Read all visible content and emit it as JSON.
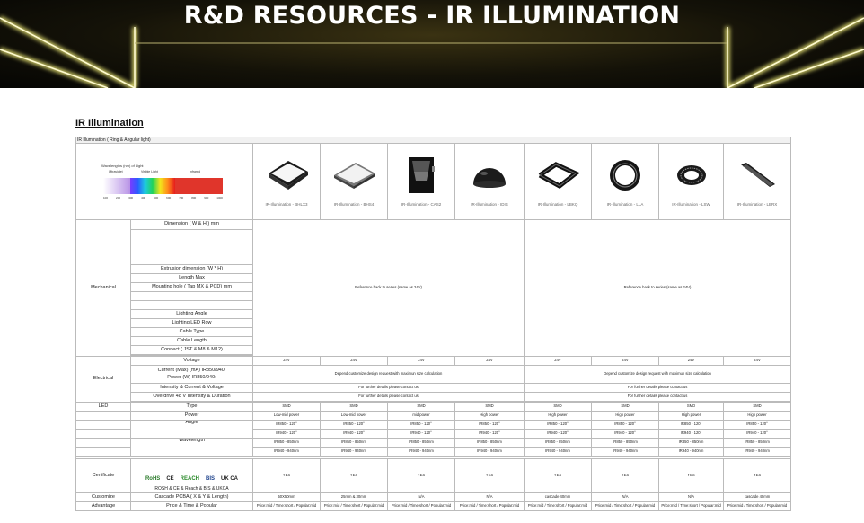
{
  "hero": {
    "title": "R&D RESOURCES - IR ILLUMINATION"
  },
  "section": {
    "title": "IR Illumination"
  },
  "table": {
    "caption": "IR Illumination ( Ring & Angular light)",
    "spectrum": {
      "title": "Wavelengths (nm) of Light",
      "bands": [
        "Ultraviolet",
        "Visible Light",
        "Infrared"
      ],
      "ticks": [
        "100",
        "200",
        "300",
        "400",
        "500",
        "600",
        "700",
        "800",
        "900",
        "1000"
      ]
    },
    "products": [
      "IR-Illumination - BHLX3",
      "IR-Illumination - BHS4",
      "IR-Illumination - CAS2",
      "IR-Illumination - IDIS",
      "IR-Illumination - LBKQ",
      "IR-Illumination - LLA",
      "IR-Illumination - LSW",
      "IR-Illumination - LBRX"
    ],
    "groups": {
      "mechanical": "Mechanical",
      "electrical": "Electrical",
      "led": "LED",
      "certificate": "Certificate",
      "customize": "Customize",
      "advantage": "Advantage"
    },
    "labels": {
      "dimension": "Dimension ( W & H ) mm",
      "extrusion": "Extrusion dimension (W * H)",
      "length": "Length Max",
      "mounting": "Mounting hole ( Tap MX & PCD) mm",
      "angle": "Lighting  Angle",
      "ledrow": "Lighting LED Row",
      "cabletype": "Cable Type",
      "cablelength": "Cable Length",
      "connect": "Connect ( JST & M8 & M12)",
      "voltage": "Voltage",
      "current": "Current (Max) (mA) IR850/940:",
      "power": "Power (W) IR850/940:",
      "intensity": "Intensity & Current & Voltage",
      "overdrive": "Overdrive 48 V Intensity & Duration",
      "type": "Type",
      "ledpower": "Power",
      "ledangle": "Angle",
      "wavelength": "Wavelength",
      "certnames": "ROSH & CE & Reach & BIS & UKCA",
      "cascade": "Cascade PCBA ( X & Y & Length)",
      "price": "Price & Time & Popular"
    },
    "cert_logos": [
      "RoHS",
      "CE",
      "REACH",
      "BIS",
      "UK CA"
    ],
    "mech_note": "Reference back to series (same as 24V)",
    "voltage": "24V",
    "elec_note": "Depend customize design request with maximun size calculation",
    "contact_note": "For further details please contact us",
    "led_type": "SMD",
    "led_power": [
      "Low-mid power",
      "Low-mid power",
      "mid power",
      "High power",
      "High power",
      "High power",
      "High power",
      "High power"
    ],
    "angle_850": "IR850 - 120°",
    "angle_940": "IR940 - 120°",
    "wl_850": "IR850 - 850nm",
    "wl_940": "IR940 - 940nm",
    "cert_yes": "YES",
    "cascade": [
      "50X50mm",
      "25mm & 30mm",
      "N/A",
      "N/A",
      "cascade 40mm",
      "N/A",
      "N/A",
      "cascade 40mm"
    ],
    "price": "Price:mid / Time:short / Popular:mid"
  }
}
